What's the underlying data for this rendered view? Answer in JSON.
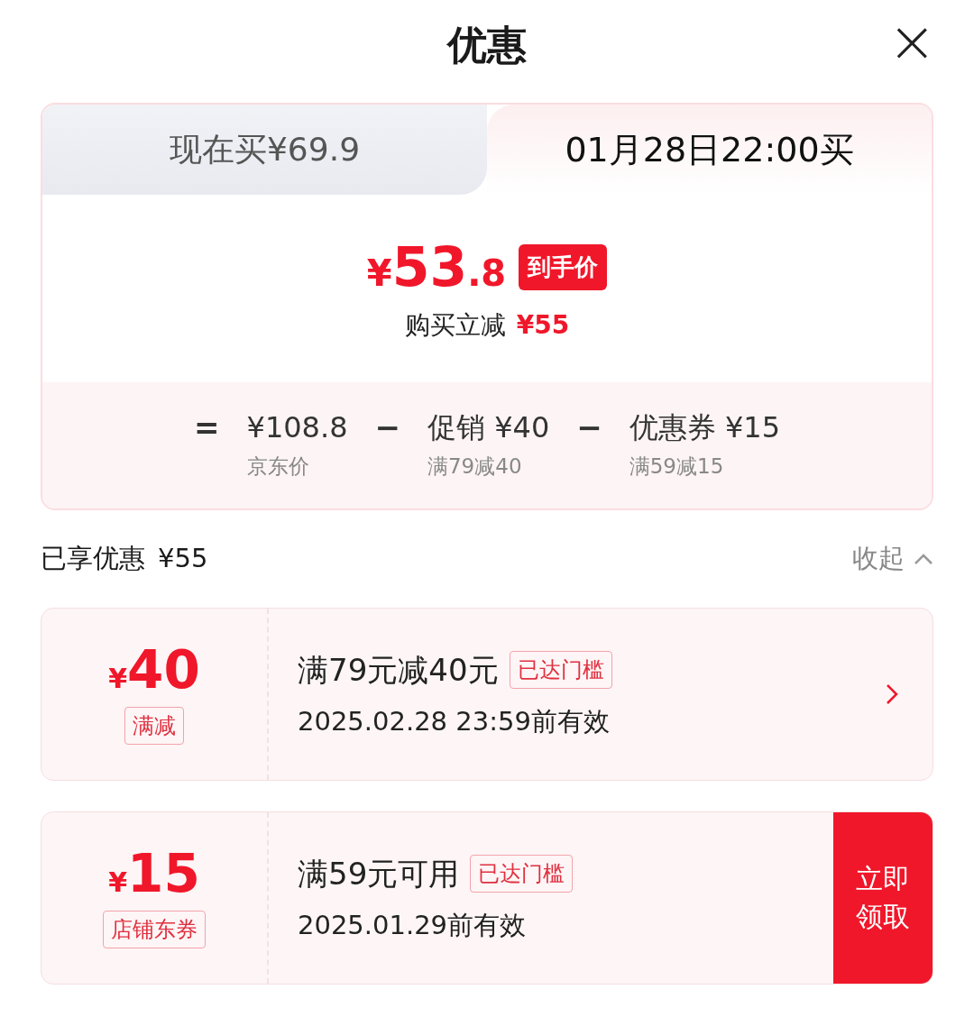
{
  "header": {
    "title": "优惠",
    "close": "×"
  },
  "tabs": [
    {
      "label": "现在买¥69.9",
      "selected": false
    },
    {
      "label": "01月28日22:00买",
      "selected": true
    }
  ],
  "price": {
    "symbol": "¥",
    "integer": "53",
    "decimal": ".8",
    "badge": "到手价",
    "saving_label": "购买立减",
    "saving_value": "¥55"
  },
  "breakdown": [
    {
      "operator": "=",
      "value": "¥108.8",
      "note": "京东价"
    },
    {
      "operator": "−",
      "value": "促销 ¥40",
      "note": "满79减40"
    },
    {
      "operator": "−",
      "value": "优惠券 ¥15",
      "note": "满59减15"
    }
  ],
  "summary": {
    "label": "已享优惠",
    "value": "¥55",
    "toggle": "收起"
  },
  "coupons": [
    {
      "symbol": "¥",
      "amount": "40",
      "type": "满减",
      "title": "满79元减40元",
      "tag": "已达门槛",
      "validity": "2025.02.28 23:59前有效",
      "kind": "arrow"
    },
    {
      "symbol": "¥",
      "amount": "15",
      "type": "店铺东券",
      "title": "满59元可用",
      "tag": "已达门槛",
      "validity": "2025.01.29前有效",
      "kind": "claim",
      "action": "立即领取"
    }
  ]
}
